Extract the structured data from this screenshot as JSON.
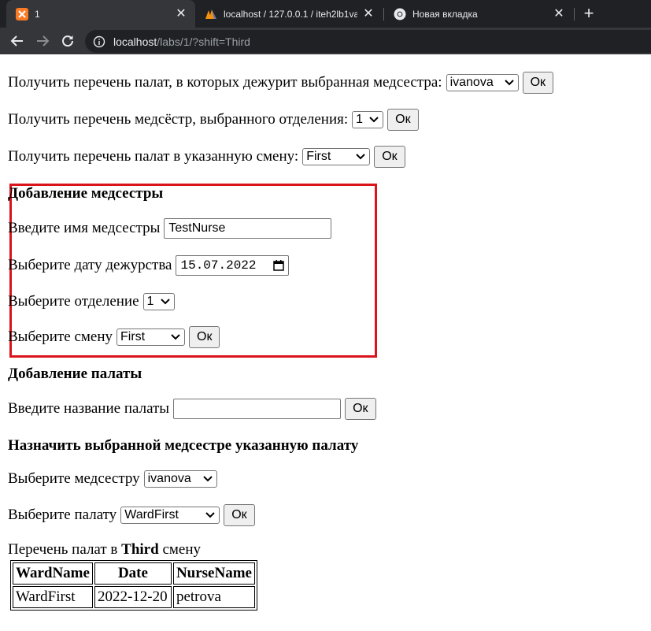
{
  "browser": {
    "tabs": [
      {
        "title": "1",
        "active": true,
        "favicon": "xampp-icon"
      },
      {
        "title": "localhost / 127.0.0.1 / iteh2lb1vari",
        "active": false,
        "favicon": "phpmyadmin-icon"
      },
      {
        "title": "Новая вкладка",
        "active": false,
        "favicon": "chrome-icon"
      }
    ],
    "url_host": "localhost",
    "url_path": "/labs/1/?shift=Third"
  },
  "queries": {
    "wards_by_nurse": {
      "label": "Получить перечень палат, в которых дежурит выбранная медсестра:",
      "selected": "ivanova",
      "button": "Ок"
    },
    "nurses_by_department": {
      "label": "Получить перечень медсёстр, выбранного отделения:",
      "selected": "1",
      "button": "Ок"
    },
    "wards_by_shift": {
      "label": "Получить перечень палат в указанную смену:",
      "selected": "First",
      "button": "Ок"
    }
  },
  "add_nurse": {
    "heading": "Добавление медсестры",
    "name_label": "Введите имя медсестры",
    "name_value": "TestNurse",
    "date_label": "Выберите дату дежурства",
    "date_value": "15.07.2022",
    "department_label": "Выберите отделение",
    "department_selected": "1",
    "shift_label": "Выберите смену",
    "shift_selected": "First",
    "button": "Ок",
    "highlight_color": "#d9141b"
  },
  "add_ward": {
    "heading": "Добавление палаты",
    "name_label": "Введите название палаты",
    "name_value": "",
    "button": "Ок"
  },
  "assign": {
    "heading": "Назначить выбранной медсестре указанную палату",
    "nurse_label": "Выберите медсестру",
    "nurse_selected": "ivanova",
    "ward_label": "Выберите палату",
    "ward_selected": "WardFirst",
    "button": "Ок"
  },
  "result": {
    "caption_prefix": "Перечень палат в",
    "shift": "Third",
    "caption_suffix": "смену",
    "columns": [
      "WardName",
      "Date",
      "NurseName"
    ],
    "rows": [
      [
        "WardFirst",
        "2022-12-20",
        "petrova"
      ]
    ]
  }
}
